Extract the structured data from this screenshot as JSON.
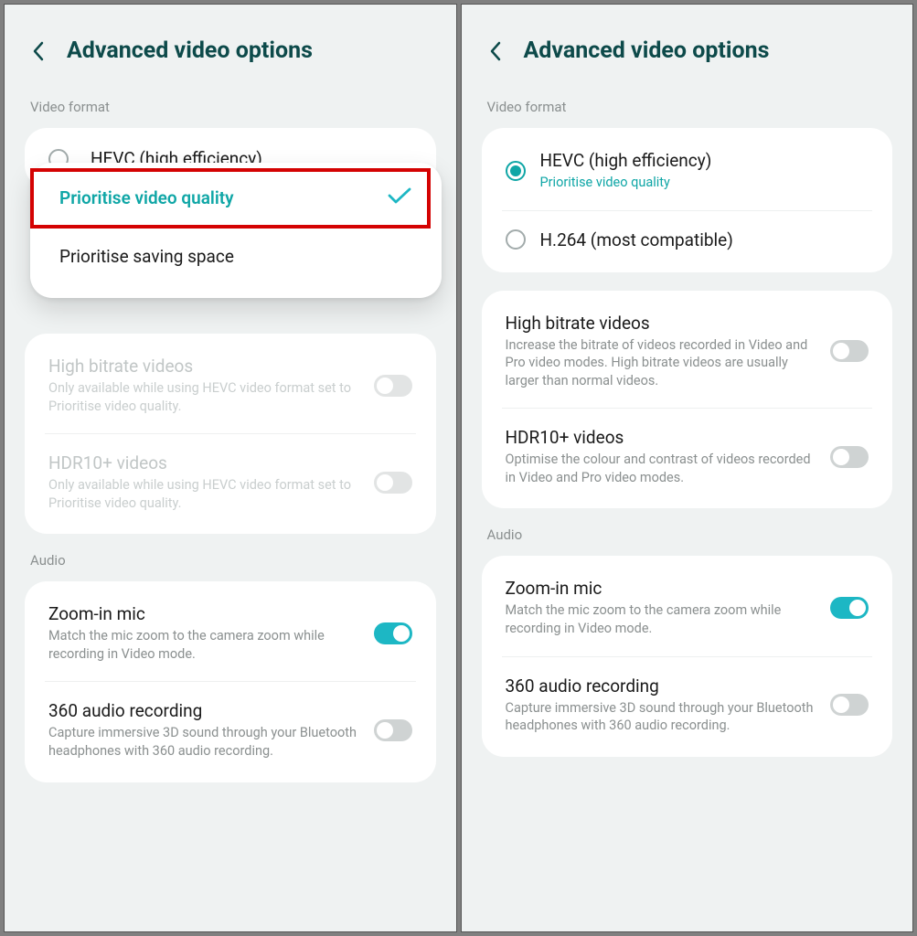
{
  "left": {
    "title": "Advanced video options",
    "video_format_label": "Video format",
    "hevc_label": "HEVC (high efficiency)",
    "popup_opt1": "Prioritise video quality",
    "popup_opt2": "Prioritise saving space",
    "high_bitrate_title": "High bitrate videos",
    "high_bitrate_sub": "Only available while using HEVC video format set to Prioritise video quality.",
    "hdr_title": "HDR10+ videos",
    "hdr_sub": "Only available while using HEVC video format set to Prioritise video quality.",
    "audio_label": "Audio",
    "zoom_mic_title": "Zoom-in mic",
    "zoom_mic_sub": "Match the mic zoom to the camera zoom while recording in Video mode.",
    "audio360_title": "360 audio recording",
    "audio360_sub": "Capture immersive 3D sound through your Bluetooth headphones with 360 audio recording."
  },
  "right": {
    "title": "Advanced video options",
    "video_format_label": "Video format",
    "hevc_label": "HEVC (high efficiency)",
    "hevc_sub": "Prioritise video quality",
    "h264_label": "H.264 (most compatible)",
    "high_bitrate_title": "High bitrate videos",
    "high_bitrate_sub": "Increase the bitrate of videos recorded in Video and Pro video modes. High bitrate videos are usually larger than normal videos.",
    "hdr_title": "HDR10+ videos",
    "hdr_sub": "Optimise the colour and contrast of videos recorded in Video and Pro video modes.",
    "audio_label": "Audio",
    "zoom_mic_title": "Zoom-in mic",
    "zoom_mic_sub": "Match the mic zoom to the camera zoom while recording in Video mode.",
    "audio360_title": "360 audio recording",
    "audio360_sub": "Capture immersive 3D sound through your Bluetooth headphones with 360 audio recording."
  }
}
